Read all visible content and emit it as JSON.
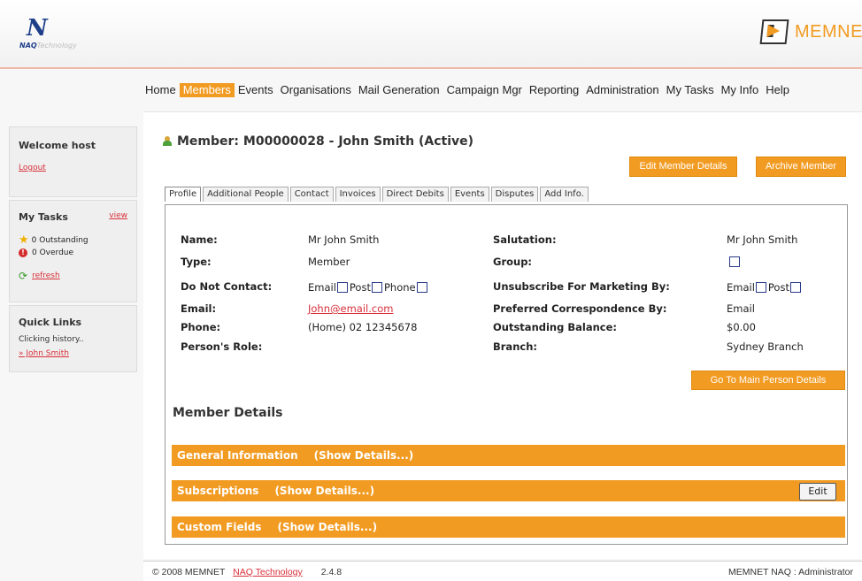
{
  "brand": {
    "logo_left_letter": "N",
    "logo_left_naq": "NAQ",
    "logo_left_rest": "Technology",
    "logo_right_text": "MEMNET"
  },
  "colors": {
    "accent": "#f29b22",
    "link": "#d8303a",
    "brand_blue": "#1d3f8a"
  },
  "nav": {
    "items": [
      {
        "label": "Home"
      },
      {
        "label": "Members",
        "active": true
      },
      {
        "label": "Events"
      },
      {
        "label": "Organisations"
      },
      {
        "label": "Mail Generation"
      },
      {
        "label": "Campaign Mgr"
      },
      {
        "label": "Reporting"
      },
      {
        "label": "Administration"
      },
      {
        "label": "My Tasks"
      },
      {
        "label": "My Info"
      },
      {
        "label": "Help"
      }
    ]
  },
  "sidebar": {
    "welcome": "Welcome host",
    "logout": "Logout",
    "tasks_title": "My Tasks",
    "tasks_view": "view",
    "outstanding": "0 Outstanding",
    "overdue_badge": "!",
    "overdue": "0 Overdue",
    "refresh": "refresh",
    "quick_links_title": "Quick Links",
    "quick_links_sub": "Clicking history..",
    "quick_link_item": "» John Smith"
  },
  "member": {
    "title": "Member: M00000028 - John Smith (Active)",
    "edit_button": "Edit Member Details",
    "archive_button": "Archive Member"
  },
  "tabs": [
    {
      "label": "Profile",
      "active": true
    },
    {
      "label": "Additional People"
    },
    {
      "label": "Contact"
    },
    {
      "label": "Invoices"
    },
    {
      "label": "Direct Debits"
    },
    {
      "label": "Events"
    },
    {
      "label": "Disputes"
    },
    {
      "label": "Add Info."
    }
  ],
  "profile": {
    "name_label": "Name:",
    "name_value": "Mr John Smith",
    "type_label": "Type:",
    "type_value": "Member",
    "dnc_label": "Do Not Contact:",
    "dnc_email": "Email",
    "dnc_post": "Post",
    "dnc_phone": "Phone",
    "email_label": "Email:",
    "email_value": "John@email.com",
    "phone_label": "Phone:",
    "phone_value": "(Home) 02 12345678",
    "role_label": "Person's Role:",
    "salutation_label": "Salutation:",
    "salutation_value": "Mr John Smith",
    "group_label": "Group:",
    "unsub_label": "Unsubscribe For Marketing By:",
    "unsub_email": "Email",
    "unsub_post": "Post",
    "pref_label": "Preferred Correspondence By:",
    "pref_value": "Email",
    "balance_label": "Outstanding Balance:",
    "balance_value": "$0.00",
    "branch_label": "Branch:",
    "branch_value": "Sydney Branch",
    "goto_button": "Go To Main Person Details"
  },
  "details": {
    "title": "Member Details",
    "general": "General Information",
    "subscriptions": "Subscriptions",
    "custom": "Custom Fields",
    "show": "(Show Details...)",
    "edit": "Edit"
  },
  "footer": {
    "copyright": "© 2008 MEMNET",
    "company_link": "NAQ Technology",
    "version": "2.4.8",
    "user": "MEMNET NAQ : Administrator"
  }
}
